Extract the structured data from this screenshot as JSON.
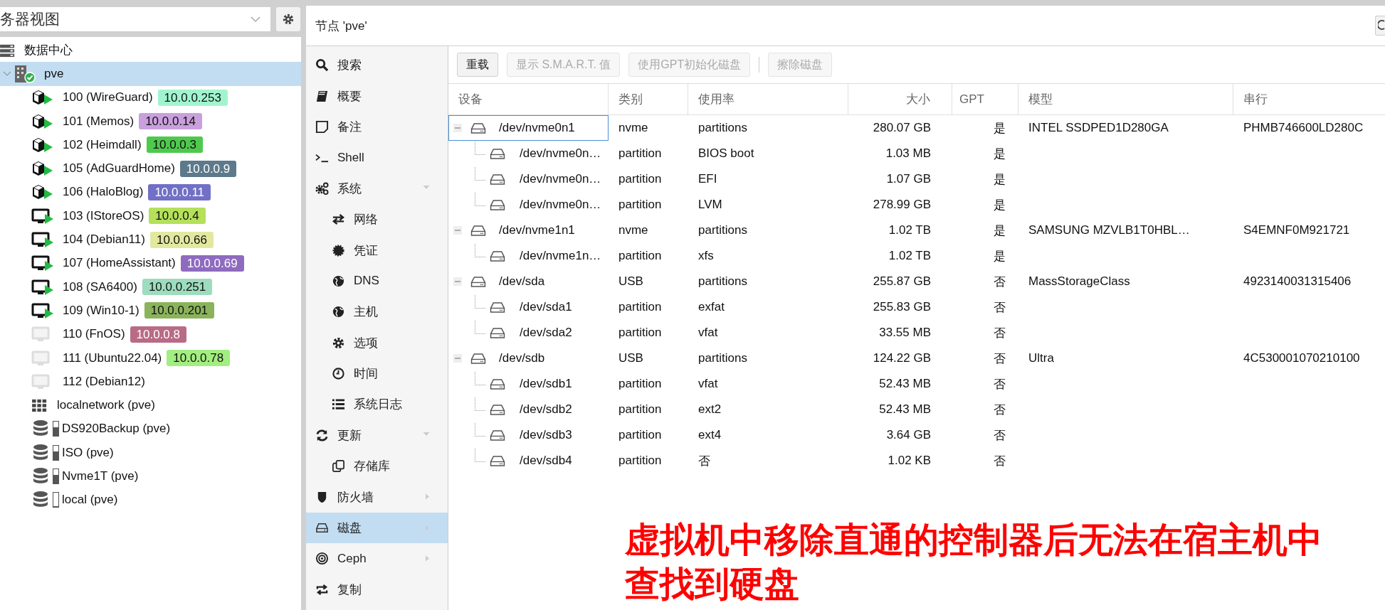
{
  "view_selector": {
    "value": "务器视图"
  },
  "tree": [
    {
      "label": "数据中心",
      "kind": "datacenter",
      "selected": false,
      "children": [
        {
          "label": "pve",
          "kind": "node",
          "selected": true,
          "expanded": true,
          "children": [
            {
              "label": "100 (WireGuard)",
              "kind": "container",
              "running": true,
              "tag": "10.0.0.253",
              "color": "#a0f5cf",
              "selected": false
            },
            {
              "label": "101 (Memos)",
              "kind": "container",
              "running": true,
              "tag": "10.0.0.14",
              "color": "#c99fdd",
              "selected": false
            },
            {
              "label": "102 (Heimdall)",
              "kind": "container",
              "running": true,
              "tag": "10.0.0.3",
              "color": "#4ec94e",
              "selected": false
            },
            {
              "label": "105 (AdGuardHome)",
              "kind": "container",
              "running": true,
              "tag": "10.0.0.9",
              "color": "#5c7a8b",
              "selected": false
            },
            {
              "label": "106 (HaloBlog)",
              "kind": "container",
              "running": true,
              "tag": "10.0.0.11",
              "color": "#7170c6",
              "selected": false
            },
            {
              "label": "103 (IStoreOS)",
              "kind": "vm",
              "running": true,
              "tag": "10.0.0.4",
              "color": "#b4e05a",
              "selected": false
            },
            {
              "label": "104 (Debian11)",
              "kind": "vm",
              "running": true,
              "tag": "10.0.0.66",
              "color": "#e2e8a0",
              "selected": false
            },
            {
              "label": "107 (HomeAssistant)",
              "kind": "vm",
              "running": true,
              "tag": "10.0.0.69",
              "color": "#8f6bbf",
              "selected": false
            },
            {
              "label": "108 (SA6400)",
              "kind": "vm",
              "running": true,
              "tag": "10.0.0.251",
              "color": "#9ddcbe",
              "selected": false
            },
            {
              "label": "109 (Win10-1)",
              "kind": "vm",
              "running": true,
              "tag": "10.0.0.201",
              "color": "#8ab35b",
              "selected": false
            },
            {
              "label": "110 (FnOS)",
              "kind": "vm",
              "running": false,
              "tag": "10.0.0.8",
              "color": "#b86b86",
              "selected": false
            },
            {
              "label": "111 (Ubuntu22.04)",
              "kind": "vm",
              "running": false,
              "tag": "10.0.0.78",
              "color": "#a2ee80",
              "selected": false
            },
            {
              "label": "112 (Debian12)",
              "kind": "vm",
              "running": false,
              "selected": false
            },
            {
              "label": "localnetwork (pve)",
              "kind": "sdn",
              "selected": false
            },
            {
              "label": "DS920Backup (pve)",
              "kind": "storage",
              "level": 0.6,
              "selected": false
            },
            {
              "label": "ISO (pve)",
              "kind": "storage",
              "level": 0.6,
              "selected": false
            },
            {
              "label": "Nvme1T (pve)",
              "kind": "storage",
              "level": 0.6,
              "selected": false
            },
            {
              "label": "local (pve)",
              "kind": "storage",
              "level": 0.05,
              "selected": false
            }
          ]
        }
      ]
    }
  ],
  "panel_title": "节点 'pve'",
  "nav": [
    {
      "label": "搜索",
      "selected": false
    },
    {
      "label": "概要",
      "selected": false
    },
    {
      "label": "备注",
      "selected": false
    },
    {
      "label": "Shell",
      "selected": false
    },
    {
      "label": "系统",
      "selected": false,
      "expanded": true,
      "children": [
        {
          "label": "网络",
          "selected": false
        },
        {
          "label": "凭证",
          "selected": false
        },
        {
          "label": "DNS",
          "selected": false
        },
        {
          "label": "主机",
          "selected": false
        },
        {
          "label": "选项",
          "selected": false
        },
        {
          "label": "时间",
          "selected": false
        },
        {
          "label": "系统日志",
          "selected": false
        }
      ]
    },
    {
      "label": "更新",
      "selected": false,
      "expanded": true,
      "children": [
        {
          "label": "存储库",
          "selected": false
        }
      ]
    },
    {
      "label": "防火墙",
      "selected": false,
      "expanded": false
    },
    {
      "label": "磁盘",
      "selected": true,
      "expanded": false
    },
    {
      "label": "Ceph",
      "selected": false,
      "expanded": false
    },
    {
      "label": "复制",
      "selected": false
    }
  ],
  "toolbar": [
    {
      "label": "重载",
      "disabled": false
    },
    {
      "label": "显示 S.M.A.R.T. 值",
      "disabled": true
    },
    {
      "label": "使用GPT初始化磁盘",
      "disabled": true
    },
    {
      "label": "擦除磁盘",
      "disabled": true
    }
  ],
  "columns": [
    "设备",
    "类别",
    "使用率",
    "大小",
    "GPT",
    "模型",
    "串行"
  ],
  "disks": [
    {
      "device": "/dev/nvme0n1",
      "type": "nvme",
      "usage": "partitions",
      "size": "280.07 GB",
      "gpt": "是",
      "model": "INTEL SSDPED1D280GA",
      "serial": "PHMB746600LD280C",
      "selected": true,
      "expanded": true,
      "children": [
        {
          "device": "/dev/nvme0n…",
          "type": "partition",
          "usage": "BIOS boot",
          "size": "1.03 MB",
          "gpt": "是",
          "selected": false
        },
        {
          "device": "/dev/nvme0n…",
          "type": "partition",
          "usage": "EFI",
          "size": "1.07 GB",
          "gpt": "是",
          "selected": false
        },
        {
          "device": "/dev/nvme0n…",
          "type": "partition",
          "usage": "LVM",
          "size": "278.99 GB",
          "gpt": "是",
          "selected": false
        }
      ]
    },
    {
      "device": "/dev/nvme1n1",
      "type": "nvme",
      "usage": "partitions",
      "size": "1.02 TB",
      "gpt": "是",
      "model": "SAMSUNG MZVLB1T0HBL…",
      "serial": "S4EMNF0M921721",
      "selected": false,
      "expanded": true,
      "children": [
        {
          "device": "/dev/nvme1n…",
          "type": "partition",
          "usage": "xfs",
          "size": "1.02 TB",
          "gpt": "是",
          "selected": false
        }
      ]
    },
    {
      "device": "/dev/sda",
      "type": "USB",
      "usage": "partitions",
      "size": "255.87 GB",
      "gpt": "否",
      "model": "MassStorageClass",
      "serial": "4923140031315406",
      "selected": false,
      "expanded": true,
      "children": [
        {
          "device": "/dev/sda1",
          "type": "partition",
          "usage": "exfat",
          "size": "255.83 GB",
          "gpt": "否",
          "selected": false
        },
        {
          "device": "/dev/sda2",
          "type": "partition",
          "usage": "vfat",
          "size": "33.55 MB",
          "gpt": "否",
          "selected": false
        }
      ]
    },
    {
      "device": "/dev/sdb",
      "type": "USB",
      "usage": "partitions",
      "size": "124.22 GB",
      "gpt": "否",
      "model": "Ultra",
      "serial": "4C530001070210100",
      "selected": false,
      "expanded": true,
      "children": [
        {
          "device": "/dev/sdb1",
          "type": "partition",
          "usage": "vfat",
          "size": "52.43 MB",
          "gpt": "否",
          "selected": false
        },
        {
          "device": "/dev/sdb2",
          "type": "partition",
          "usage": "ext2",
          "size": "52.43 MB",
          "gpt": "否",
          "selected": false
        },
        {
          "device": "/dev/sdb3",
          "type": "partition",
          "usage": "ext4",
          "size": "3.64 GB",
          "gpt": "否",
          "selected": false
        },
        {
          "device": "/dev/sdb4",
          "type": "partition",
          "usage": "否",
          "size": "1.02 KB",
          "gpt": "否",
          "selected": false
        }
      ]
    }
  ],
  "annotation": "虚拟机中移除直通的控制器后无法在宿主机中查找到硬盘"
}
